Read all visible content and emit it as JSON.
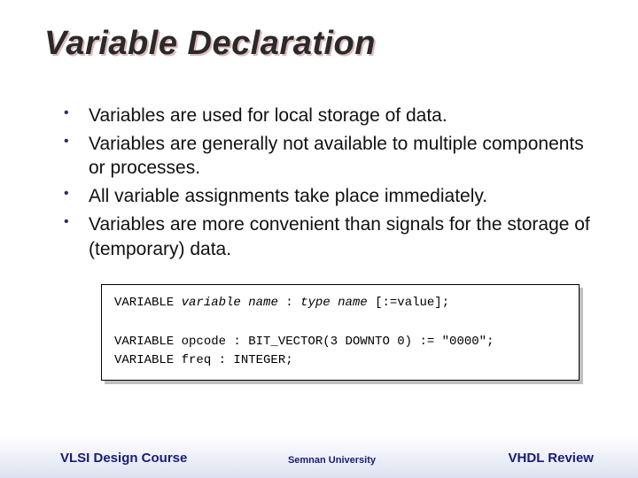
{
  "title": "Variable Declaration",
  "bullets": [
    "Variables are used for local storage of data.",
    "Variables are generally not available to multiple components or processes.",
    "All variable assignments take place immediately.",
    "Variables are more convenient than signals for the storage of (temporary) data."
  ],
  "code": {
    "line1_kw1": "VARIABLE ",
    "line1_it1": "variable name",
    "line1_mid": " : ",
    "line1_it2": "type name",
    "line1_tail": " [:=value];",
    "line2": "VARIABLE opcode : BIT_VECTOR(3 DOWNTO 0) := \"0000\";",
    "line3": "VARIABLE freq : INTEGER;"
  },
  "footer": {
    "left": "VLSI Design Course",
    "center": "Semnan University",
    "right": "VHDL Review"
  }
}
